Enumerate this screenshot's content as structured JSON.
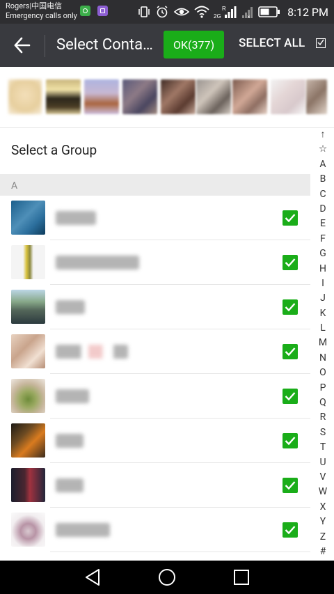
{
  "status_bar": {
    "carrier_line1": "Rogers|中国电信",
    "carrier_line2": "Emergency calls only",
    "network_label": "2G",
    "roaming_label": "R",
    "time": "8:12 PM"
  },
  "toolbar": {
    "title": "Select Contacts",
    "ok_label": "OK(377)",
    "select_all_label": "SELECT ALL"
  },
  "select_group_label": "Select a Group",
  "section_letter": "A",
  "index_letters": [
    "↑",
    "☆",
    "A",
    "B",
    "C",
    "D",
    "E",
    "F",
    "G",
    "H",
    "I",
    "J",
    "K",
    "L",
    "M",
    "N",
    "O",
    "P",
    "Q",
    "R",
    "S",
    "T",
    "U",
    "V",
    "W",
    "X",
    "Y",
    "Z",
    "#"
  ],
  "colors": {
    "accent_green": "#1aad19",
    "toolbar_bg": "#393a3f",
    "statusbar_bg": "#2e2e31"
  },
  "contacts": [
    {
      "checked": true
    },
    {
      "checked": true
    },
    {
      "checked": true
    },
    {
      "checked": true
    },
    {
      "checked": true
    },
    {
      "checked": true
    },
    {
      "checked": true
    },
    {
      "checked": true
    }
  ]
}
